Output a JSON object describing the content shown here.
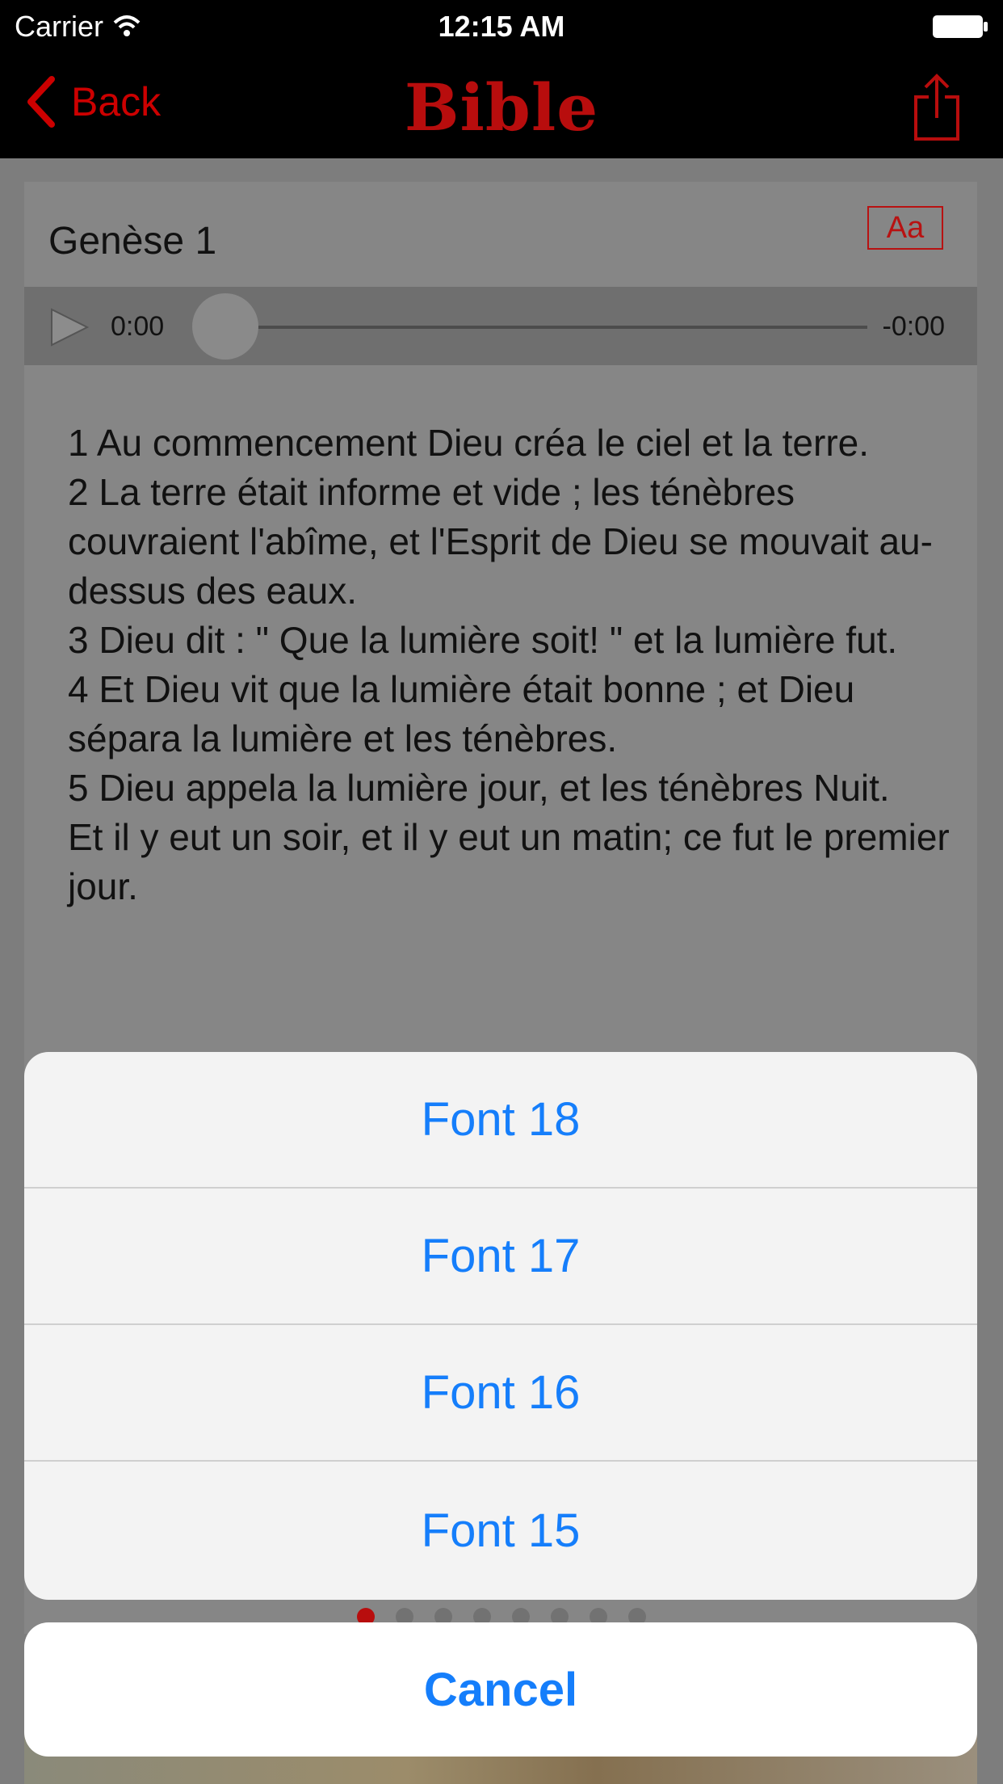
{
  "status_bar": {
    "carrier": "Carrier",
    "time": "12:15 AM"
  },
  "nav": {
    "back_label": "Back",
    "title": "Bible"
  },
  "chapter": {
    "title": "Genèse 1",
    "font_button_label": "Aa"
  },
  "audio": {
    "current_time": "0:00",
    "remaining_time": "-0:00",
    "progress": 0
  },
  "verses_text": "1 Au commencement Dieu créa le ciel et la terre.\n2 La terre était informe et vide ; les ténèbres couvraient l'abîme, et l'Esprit de Dieu se mouvait au-dessus des eaux.\n3 Dieu dit : \" Que la lumière soit! \" et la lumière fut.\n4 Et Dieu vit que la lumière était bonne ; et Dieu sépara la lumière et les ténèbres.\n5 Dieu appela la lumière jour, et les ténèbres Nuit.\nEt il y eut un soir, et il y eut un matin; ce fut le premier jour.",
  "action_sheet": {
    "options": [
      "Font 18",
      "Font 17",
      "Font 16",
      "Font 15"
    ],
    "cancel_label": "Cancel"
  },
  "colors": {
    "accent_red": "#b80d0d",
    "ios_blue": "#157efb"
  }
}
